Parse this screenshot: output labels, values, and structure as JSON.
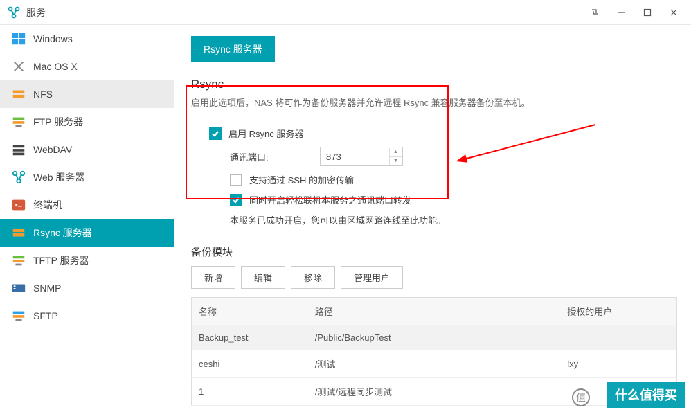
{
  "titlebar": {
    "title": "服务"
  },
  "sidebar": {
    "items": [
      {
        "label": "Windows",
        "icon": "windows"
      },
      {
        "label": "Mac OS X",
        "icon": "macos"
      },
      {
        "label": "NFS",
        "icon": "nfs"
      },
      {
        "label": "FTP 服务器",
        "icon": "ftp"
      },
      {
        "label": "WebDAV",
        "icon": "webdav"
      },
      {
        "label": "Web 服务器",
        "icon": "web"
      },
      {
        "label": "终端机",
        "icon": "terminal"
      },
      {
        "label": "Rsync 服务器",
        "icon": "rsync"
      },
      {
        "label": "TFTP 服务器",
        "icon": "tftp"
      },
      {
        "label": "SNMP",
        "icon": "snmp"
      },
      {
        "label": "SFTP",
        "icon": "sftp"
      }
    ]
  },
  "main": {
    "page_tab": "Rsync 服务器",
    "section_title": "Rsync",
    "section_desc": "启用此选项后，NAS 将可作为备份服务器并允许远程 Rsync 兼容服务器备份至本机。",
    "enable_rsync_label": "启用 Rsync 服务器",
    "port_label": "通讯端口:",
    "port_value": "873",
    "ssh_label": "支持通过 SSH 的加密传输",
    "fwd_label": "同时开启轻松联机本服务之通讯端口转发",
    "status_text": "本服务已成功开启，您可以由区域网路连线至此功能。",
    "backup_title": "备份模块",
    "buttons": {
      "add": "新增",
      "edit": "编辑",
      "remove": "移除",
      "manage": "管理用户"
    },
    "table": {
      "cols": {
        "name": "名称",
        "path": "路径",
        "user": "授权的用户"
      },
      "rows": [
        {
          "name": "Backup_test",
          "path": "/Public/BackupTest",
          "user": ""
        },
        {
          "name": "ceshi",
          "path": "/测试",
          "user": "lxy"
        },
        {
          "name": "1",
          "path": "/测试/远程同步测试",
          "user": ""
        }
      ]
    }
  },
  "watermark": {
    "text": "什么值得买",
    "circle": "值"
  }
}
